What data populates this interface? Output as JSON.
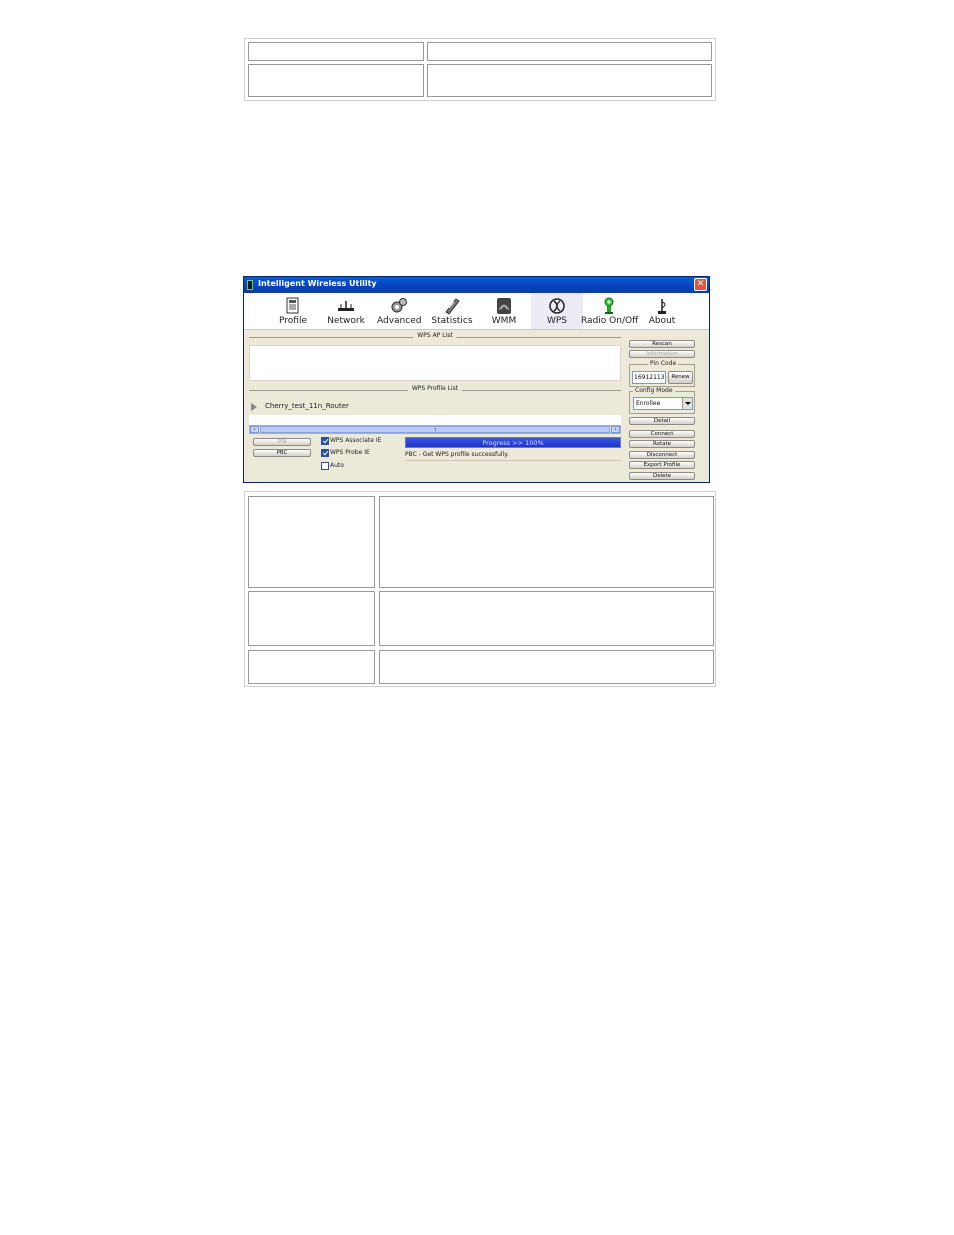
{
  "window": {
    "title": "Intelligent Wireless Utility",
    "close_glyph": "✕"
  },
  "toolbar": {
    "items": [
      {
        "label": "Profile",
        "icon": "profile-icon"
      },
      {
        "label": "Network",
        "icon": "network-icon"
      },
      {
        "label": "Advanced",
        "icon": "advanced-icon"
      },
      {
        "label": "Statistics",
        "icon": "statistics-icon"
      },
      {
        "label": "WMM",
        "icon": "wmm-icon"
      },
      {
        "label": "WPS",
        "icon": "wps-icon",
        "active": true
      },
      {
        "label": "Radio On/Off",
        "icon": "radio-icon"
      },
      {
        "label": "About",
        "icon": "about-icon"
      }
    ]
  },
  "wps": {
    "ap_list_header": "WPS AP List",
    "profile_list_header": "WPS Profile List",
    "profiles": [
      "Cherry_test_11n_Router"
    ],
    "pin_button": "PIN",
    "pbc_button": "PBC",
    "checkboxes": [
      {
        "label": "WPS Associate IE",
        "checked": true
      },
      {
        "label": "WPS Probe IE",
        "checked": true
      },
      {
        "label": "Auto",
        "checked": false
      }
    ],
    "progress_text": "Progress >> 100%",
    "progress_value": 1.0,
    "status_text": "PBC - Get WPS profile successfully."
  },
  "sidepanel": {
    "rescan": "Rescan",
    "information": "Information",
    "pin_code_label": "Pin Code",
    "pin_code_value": "16912113",
    "renew": "Renew",
    "config_mode_label": "Config Mode",
    "config_mode_value": "Enrollee",
    "detail": "Detail",
    "connect": "Connect",
    "rotate": "Rotate",
    "disconnect": "Disconnect",
    "export_profile": "Export Profile",
    "delete": "Delete"
  },
  "colors": {
    "titlebar": "#0543b8",
    "progress": "#1e34c8",
    "dialog_bg": "#ece9d8"
  }
}
